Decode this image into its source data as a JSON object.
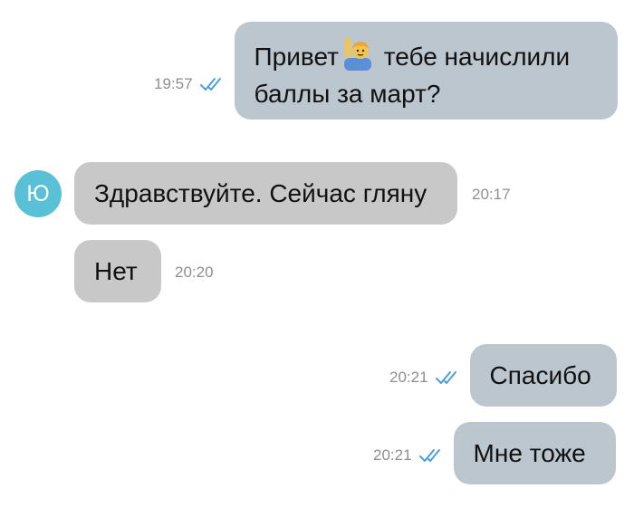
{
  "colors": {
    "outgoing_bubble": "#bcc6cf",
    "incoming_bubble": "#c8c8c8",
    "avatar_bg": "#5ac0d6",
    "read_ticks": "#4a9fe0",
    "timestamp": "#8e8e93"
  },
  "messages": [
    {
      "direction": "outgoing",
      "text_before_emoji": "Привет",
      "emoji": "person-raising-hand-emoji",
      "text_after_emoji": " тебе начислили",
      "text_line2": "баллы за март?",
      "time": "19:57",
      "status": "read-double-check-icon"
    },
    {
      "direction": "incoming",
      "avatar_letter": "Ю",
      "text": "Здравствуйте. Сейчас гляну",
      "time": "20:17"
    },
    {
      "direction": "incoming",
      "text": "Нет",
      "time": "20:20"
    },
    {
      "direction": "outgoing",
      "text": "Спасибо",
      "time": "20:21",
      "status": "read-double-check-icon"
    },
    {
      "direction": "outgoing",
      "text": "Мне тоже",
      "time": "20:21",
      "status": "read-double-check-icon"
    }
  ]
}
